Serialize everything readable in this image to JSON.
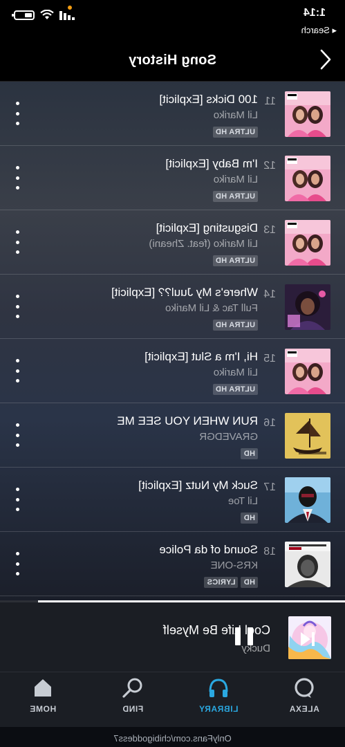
{
  "status": {
    "time": "1:14",
    "back_app": "◂ Search"
  },
  "header": {
    "title": "Song History"
  },
  "tracks": [
    {
      "num": "11",
      "title": "100 Dicks [Explicit]",
      "artist": "Lil Mariko",
      "badges": [
        "ULTRA HD"
      ],
      "art": "pink-duo-cover-explicit"
    },
    {
      "num": "12",
      "title": "I'm Baby [Explicit]",
      "artist": "Lil Mariko",
      "badges": [
        "ULTRA HD"
      ],
      "art": "pink-duo-cover-explicit"
    },
    {
      "num": "13",
      "title": "Disgusting [Explicit]",
      "artist": "Lil Mariko (feat. Zheani)",
      "badges": [
        "ULTRA HD"
      ],
      "art": "pink-duo-cover-explicit"
    },
    {
      "num": "14",
      "title": "Where's My Juul?? [Explicit]",
      "artist": "Full Tac & Lil Mariko",
      "badges": [
        "ULTRA HD"
      ],
      "art": "purple-portrait-cover"
    },
    {
      "num": "15",
      "title": "Hi, I'm a Slut [Explicit]",
      "artist": "Lil Mariko",
      "badges": [
        "ULTRA HD"
      ],
      "art": "pink-duo-cover-explicit"
    },
    {
      "num": "16",
      "title": "RUN WHEN YOU SEE ME",
      "artist": "GRAVEDGR",
      "badges": [
        "HD"
      ],
      "art": "yellow-ship-cover"
    },
    {
      "num": "17",
      "title": "Suck My Nutz [Explicit]",
      "artist": "Lil Toe",
      "badges": [
        "HD"
      ],
      "art": "masked-man-cover"
    },
    {
      "num": "18",
      "title": "Sound of da Police",
      "artist": "KRS-ONE",
      "badges": [
        "HD",
        "LYRICS"
      ],
      "art": "krs-one-bw-cover"
    }
  ],
  "now_playing": {
    "title": "Cool Life Be Myself",
    "artist": "Ducky",
    "progress": 0.89
  },
  "tabs": [
    {
      "label": "HOME",
      "icon": "home-icon",
      "active": false
    },
    {
      "label": "FIND",
      "icon": "search-icon",
      "active": false
    },
    {
      "label": "LIBRARY",
      "icon": "headphones-icon",
      "active": true
    },
    {
      "label": "ALEXA",
      "icon": "alexa-ring-icon",
      "active": false
    }
  ],
  "colors": {
    "accent": "#2aa8e0",
    "badge_bg": "#4a4f58"
  },
  "watermark": "OnlyFans.com/chibigoddess7"
}
